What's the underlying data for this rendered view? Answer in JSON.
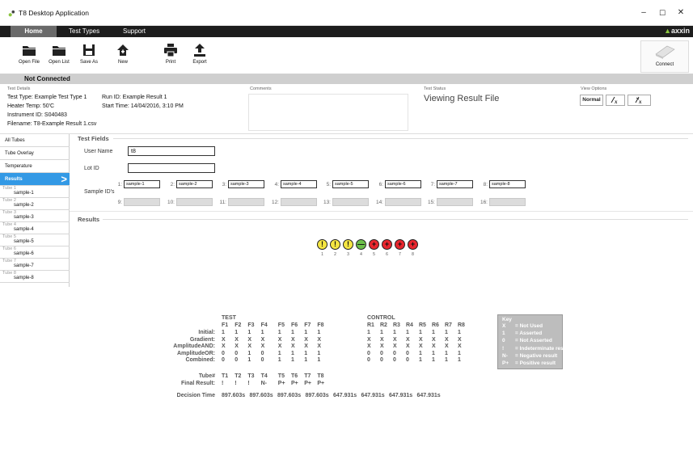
{
  "window": {
    "title": "T8 Desktop Application",
    "minimize": "–",
    "maximize": "☐",
    "close": "✕"
  },
  "menu": {
    "tabs": [
      "Home",
      "Test Types",
      "Support"
    ],
    "brand": "axxin"
  },
  "toolbar": {
    "open_file": "Open File",
    "open_list": "Open List",
    "save_as": "Save As",
    "new": "New",
    "print": "Print",
    "export": "Export",
    "connect": "Connect"
  },
  "status": {
    "connection": "Not Connected"
  },
  "test_details": {
    "caption": "Test Details",
    "test_type": "Test Type: Example Test Type 1",
    "run_id": "Run ID: Example Result 1",
    "heater_temp": "Heater Temp: 50'C",
    "start_time": "Start Time: 14/04/2016, 3:10 PM",
    "instrument_id": "Instrument ID: S040483",
    "filename": "Filename: T8-Example Result 1.csv",
    "comments_caption": "Comments",
    "status_caption": "Test Status",
    "status_value": "Viewing Result File",
    "view_options_caption": "View Options",
    "view_normal": "Normal"
  },
  "sidebar": {
    "items": [
      "All Tubes",
      "Tube Overlay",
      "Temperature",
      "Results"
    ],
    "active_arrow": ">",
    "tubes": [
      {
        "tag": "Tube 1",
        "sample": "sample-1"
      },
      {
        "tag": "Tube 2",
        "sample": "sample-2"
      },
      {
        "tag": "Tube 3",
        "sample": "sample-3"
      },
      {
        "tag": "Tube 4",
        "sample": "sample-4"
      },
      {
        "tag": "Tube 5",
        "sample": "sample-5"
      },
      {
        "tag": "Tube 6",
        "sample": "sample-6"
      },
      {
        "tag": "Tube 7",
        "sample": "sample-7"
      },
      {
        "tag": "Tube 8",
        "sample": "sample-8"
      }
    ]
  },
  "test_fields": {
    "title": "Test Fields",
    "user_name_label": "User Name",
    "user_name_value": "t8",
    "lot_id_label": "Lot ID",
    "lot_id_value": "",
    "sample_ids_label": "Sample ID's",
    "row1": [
      {
        "num": "1:",
        "value": "sample-1"
      },
      {
        "num": "2:",
        "value": "sample-2"
      },
      {
        "num": "3:",
        "value": "sample-3"
      },
      {
        "num": "4:",
        "value": "sample-4"
      },
      {
        "num": "5:",
        "value": "sample-5"
      },
      {
        "num": "6:",
        "value": "sample-6"
      },
      {
        "num": "7:",
        "value": "sample-7"
      },
      {
        "num": "8:",
        "value": "sample-8"
      }
    ],
    "row2": [
      "9:",
      "10:",
      "11:",
      "12:",
      "13:",
      "14:",
      "15:",
      "16:"
    ]
  },
  "results": {
    "title": "Results",
    "tube_icons": [
      {
        "num": "1",
        "glyph": "!",
        "color": "#f5e642"
      },
      {
        "num": "2",
        "glyph": "!",
        "color": "#f5e642"
      },
      {
        "num": "3",
        "glyph": "!",
        "color": "#f5e642"
      },
      {
        "num": "4",
        "glyph": "—",
        "color": "#6cc04a"
      },
      {
        "num": "5",
        "glyph": "+",
        "color": "#e8262e"
      },
      {
        "num": "6",
        "glyph": "+",
        "color": "#e8262e"
      },
      {
        "num": "7",
        "glyph": "+",
        "color": "#e8262e"
      },
      {
        "num": "8",
        "glyph": "+",
        "color": "#e8262e"
      }
    ],
    "test_header": "TEST",
    "control_header": "CONTROL",
    "f_cols": [
      "F1",
      "F2",
      "F3",
      "F4",
      "F5",
      "F6",
      "F7",
      "F8"
    ],
    "r_cols": [
      "R1",
      "R2",
      "R3",
      "R4",
      "R5",
      "R6",
      "R7",
      "R8"
    ],
    "rows": [
      {
        "label": "Initial:",
        "f": [
          "1",
          "1",
          "1",
          "1",
          "1",
          "1",
          "1",
          "1"
        ],
        "r": [
          "1",
          "1",
          "1",
          "1",
          "1",
          "1",
          "1",
          "1"
        ]
      },
      {
        "label": "Gradient:",
        "f": [
          "X",
          "X",
          "X",
          "X",
          "X",
          "X",
          "X",
          "X"
        ],
        "r": [
          "X",
          "X",
          "X",
          "X",
          "X",
          "X",
          "X",
          "X"
        ]
      },
      {
        "label": "AmplitudeAND:",
        "f": [
          "X",
          "X",
          "X",
          "X",
          "X",
          "X",
          "X",
          "X"
        ],
        "r": [
          "X",
          "X",
          "X",
          "X",
          "X",
          "X",
          "X",
          "X"
        ]
      },
      {
        "label": "AmplitudeOR:",
        "f": [
          "0",
          "0",
          "1",
          "0",
          "1",
          "1",
          "1",
          "1"
        ],
        "r": [
          "0",
          "0",
          "0",
          "0",
          "1",
          "1",
          "1",
          "1"
        ]
      },
      {
        "label": "Combined:",
        "f": [
          "0",
          "0",
          "1",
          "0",
          "1",
          "1",
          "1",
          "1"
        ],
        "r": [
          "0",
          "0",
          "0",
          "0",
          "1",
          "1",
          "1",
          "1"
        ]
      }
    ],
    "tube_label": "Tube#",
    "final_label": "Final Result:",
    "t_cols": [
      "T1",
      "T2",
      "T3",
      "T4",
      "T5",
      "T6",
      "T7",
      "T8"
    ],
    "final": [
      "!",
      "!",
      "!",
      "N-",
      "P+",
      "P+",
      "P+",
      "P+"
    ],
    "decision_label": "Decision Time",
    "decision_times": [
      "897.603s",
      "897.603s",
      "897.603s",
      "897.603s",
      "647.931s",
      "647.931s",
      "647.931s",
      "647.931s"
    ],
    "key": {
      "title": "Key",
      "items": [
        {
          "sym": "X",
          "desc": "= Not Used"
        },
        {
          "sym": "1",
          "desc": "= Asserted"
        },
        {
          "sym": "0",
          "desc": "= Not Asserted"
        },
        {
          "sym": "!",
          "desc": "= Indeterminate result"
        },
        {
          "sym": "N-",
          "desc": "= Negative result"
        },
        {
          "sym": "P+",
          "desc": "= Positive result"
        }
      ]
    }
  }
}
